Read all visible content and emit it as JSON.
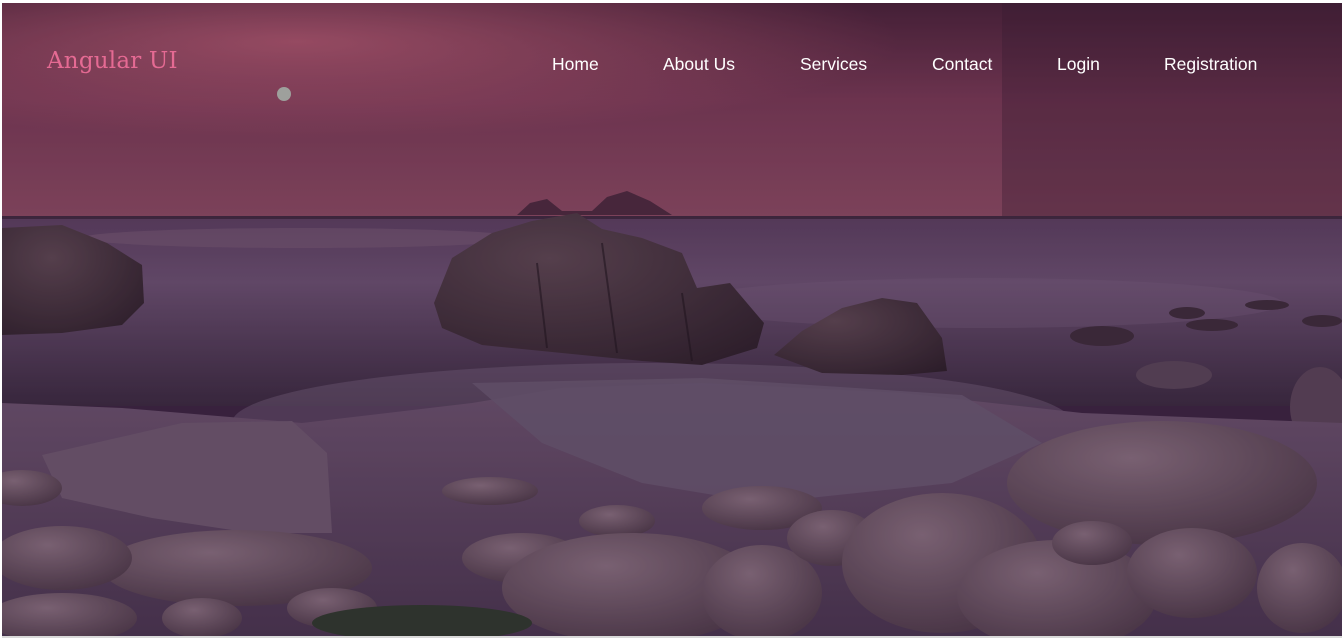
{
  "navbar": {
    "brand": "Angular UI",
    "links": [
      {
        "label": "Home"
      },
      {
        "label": "About Us"
      },
      {
        "label": "Services"
      },
      {
        "label": "Contact"
      },
      {
        "label": "Login"
      },
      {
        "label": "Registration"
      }
    ]
  },
  "colors": {
    "brand": "#e56a93",
    "nav_text": "#ffffff",
    "sky": "#8a4660",
    "sea": "#5a3f63"
  }
}
